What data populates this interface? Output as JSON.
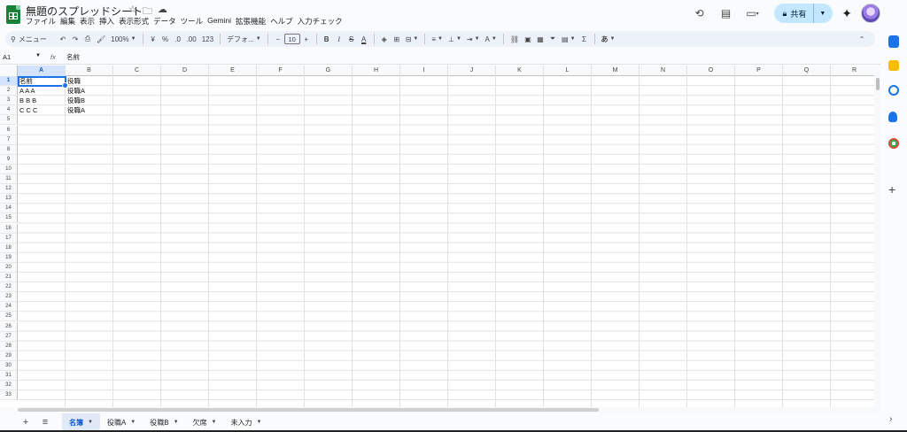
{
  "doc": {
    "title": "無題のスプレッドシート"
  },
  "menu": [
    "ファイル",
    "編集",
    "表示",
    "挿入",
    "表示形式",
    "データ",
    "ツール",
    "Gemini",
    "拡張機能",
    "ヘルプ",
    "入力チェック"
  ],
  "share": {
    "label": "共有"
  },
  "toolbar": {
    "search_label": "メニュー",
    "zoom": "100%",
    "currency": "¥",
    "percent": "%",
    "dec_decrease": ".0",
    "dec_increase": ".00",
    "number_format": "123",
    "font": "デフォ...",
    "font_size": "10",
    "bold": "B",
    "italic": "I",
    "strike": "S",
    "text_color": "A",
    "function": "Σ",
    "input_tools": "あ"
  },
  "formula_bar": {
    "cell_ref": "A1",
    "fx": "fx",
    "value": "名前"
  },
  "columns": [
    "A",
    "B",
    "C",
    "D",
    "E",
    "F",
    "G",
    "H",
    "I",
    "J",
    "K",
    "L",
    "M",
    "N",
    "O",
    "P",
    "Q",
    "R"
  ],
  "selected_column": "A",
  "rows": [
    "1",
    "2",
    "3",
    "4",
    "5",
    "6",
    "7",
    "8",
    "9",
    "10",
    "11",
    "12",
    "13",
    "14",
    "15",
    "16",
    "17",
    "18",
    "19",
    "20",
    "21",
    "22",
    "23",
    "24",
    "25",
    "26",
    "27",
    "28",
    "29",
    "30",
    "31",
    "32",
    "33"
  ],
  "cells": {
    "A1": "名前",
    "B1": "役職",
    "A2": "A A A",
    "B2": "役職A",
    "A3": "B B B",
    "B3": "役職B",
    "A4": "C C C",
    "B4": "役職A"
  },
  "sheets": [
    {
      "label": "名簿",
      "active": true
    },
    {
      "label": "役職A",
      "active": false
    },
    {
      "label": "役職B",
      "active": false
    },
    {
      "label": "欠席",
      "active": false
    },
    {
      "label": "未入力",
      "active": false
    }
  ],
  "colors": {
    "accent": "#0b57d0",
    "share_bg": "#c2e7ff",
    "sheets_green": "#188038"
  }
}
